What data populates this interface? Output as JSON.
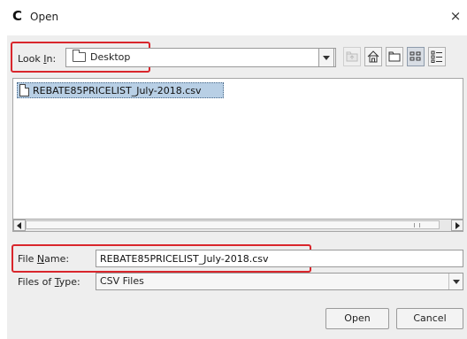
{
  "window": {
    "app_icon_letter": "C",
    "title": "Open",
    "close_glyph": "×"
  },
  "look_in": {
    "label_pre": "Look ",
    "label_mnemonic": "I",
    "label_post": "n:",
    "value": "Desktop",
    "value_icon": "folder-icon"
  },
  "toolbar": {
    "buttons": [
      {
        "name": "up-one-level-icon",
        "enabled": false
      },
      {
        "name": "home-icon",
        "enabled": true
      },
      {
        "name": "new-folder-icon",
        "enabled": true
      },
      {
        "name": "list-view-icon",
        "enabled": true,
        "selected": true
      },
      {
        "name": "details-view-icon",
        "enabled": true
      }
    ]
  },
  "file_list": {
    "items": [
      {
        "name": "REBATE85PRICELIST_July-2018.csv",
        "icon": "file-icon",
        "selected": true
      }
    ]
  },
  "file_name": {
    "label_pre": "File ",
    "label_mnemonic": "N",
    "label_post": "ame:",
    "value": "REBATE85PRICELIST_July-2018.csv"
  },
  "files_of_type": {
    "label_pre": "Files of ",
    "label_mnemonic": "T",
    "label_post": "ype:",
    "value": "CSV Files"
  },
  "buttons": {
    "open": "Open",
    "cancel": "Cancel"
  },
  "colors": {
    "highlight_box": "#d9262c",
    "selection": "#b8cfe5",
    "dialog_bg": "#eeeeee"
  }
}
